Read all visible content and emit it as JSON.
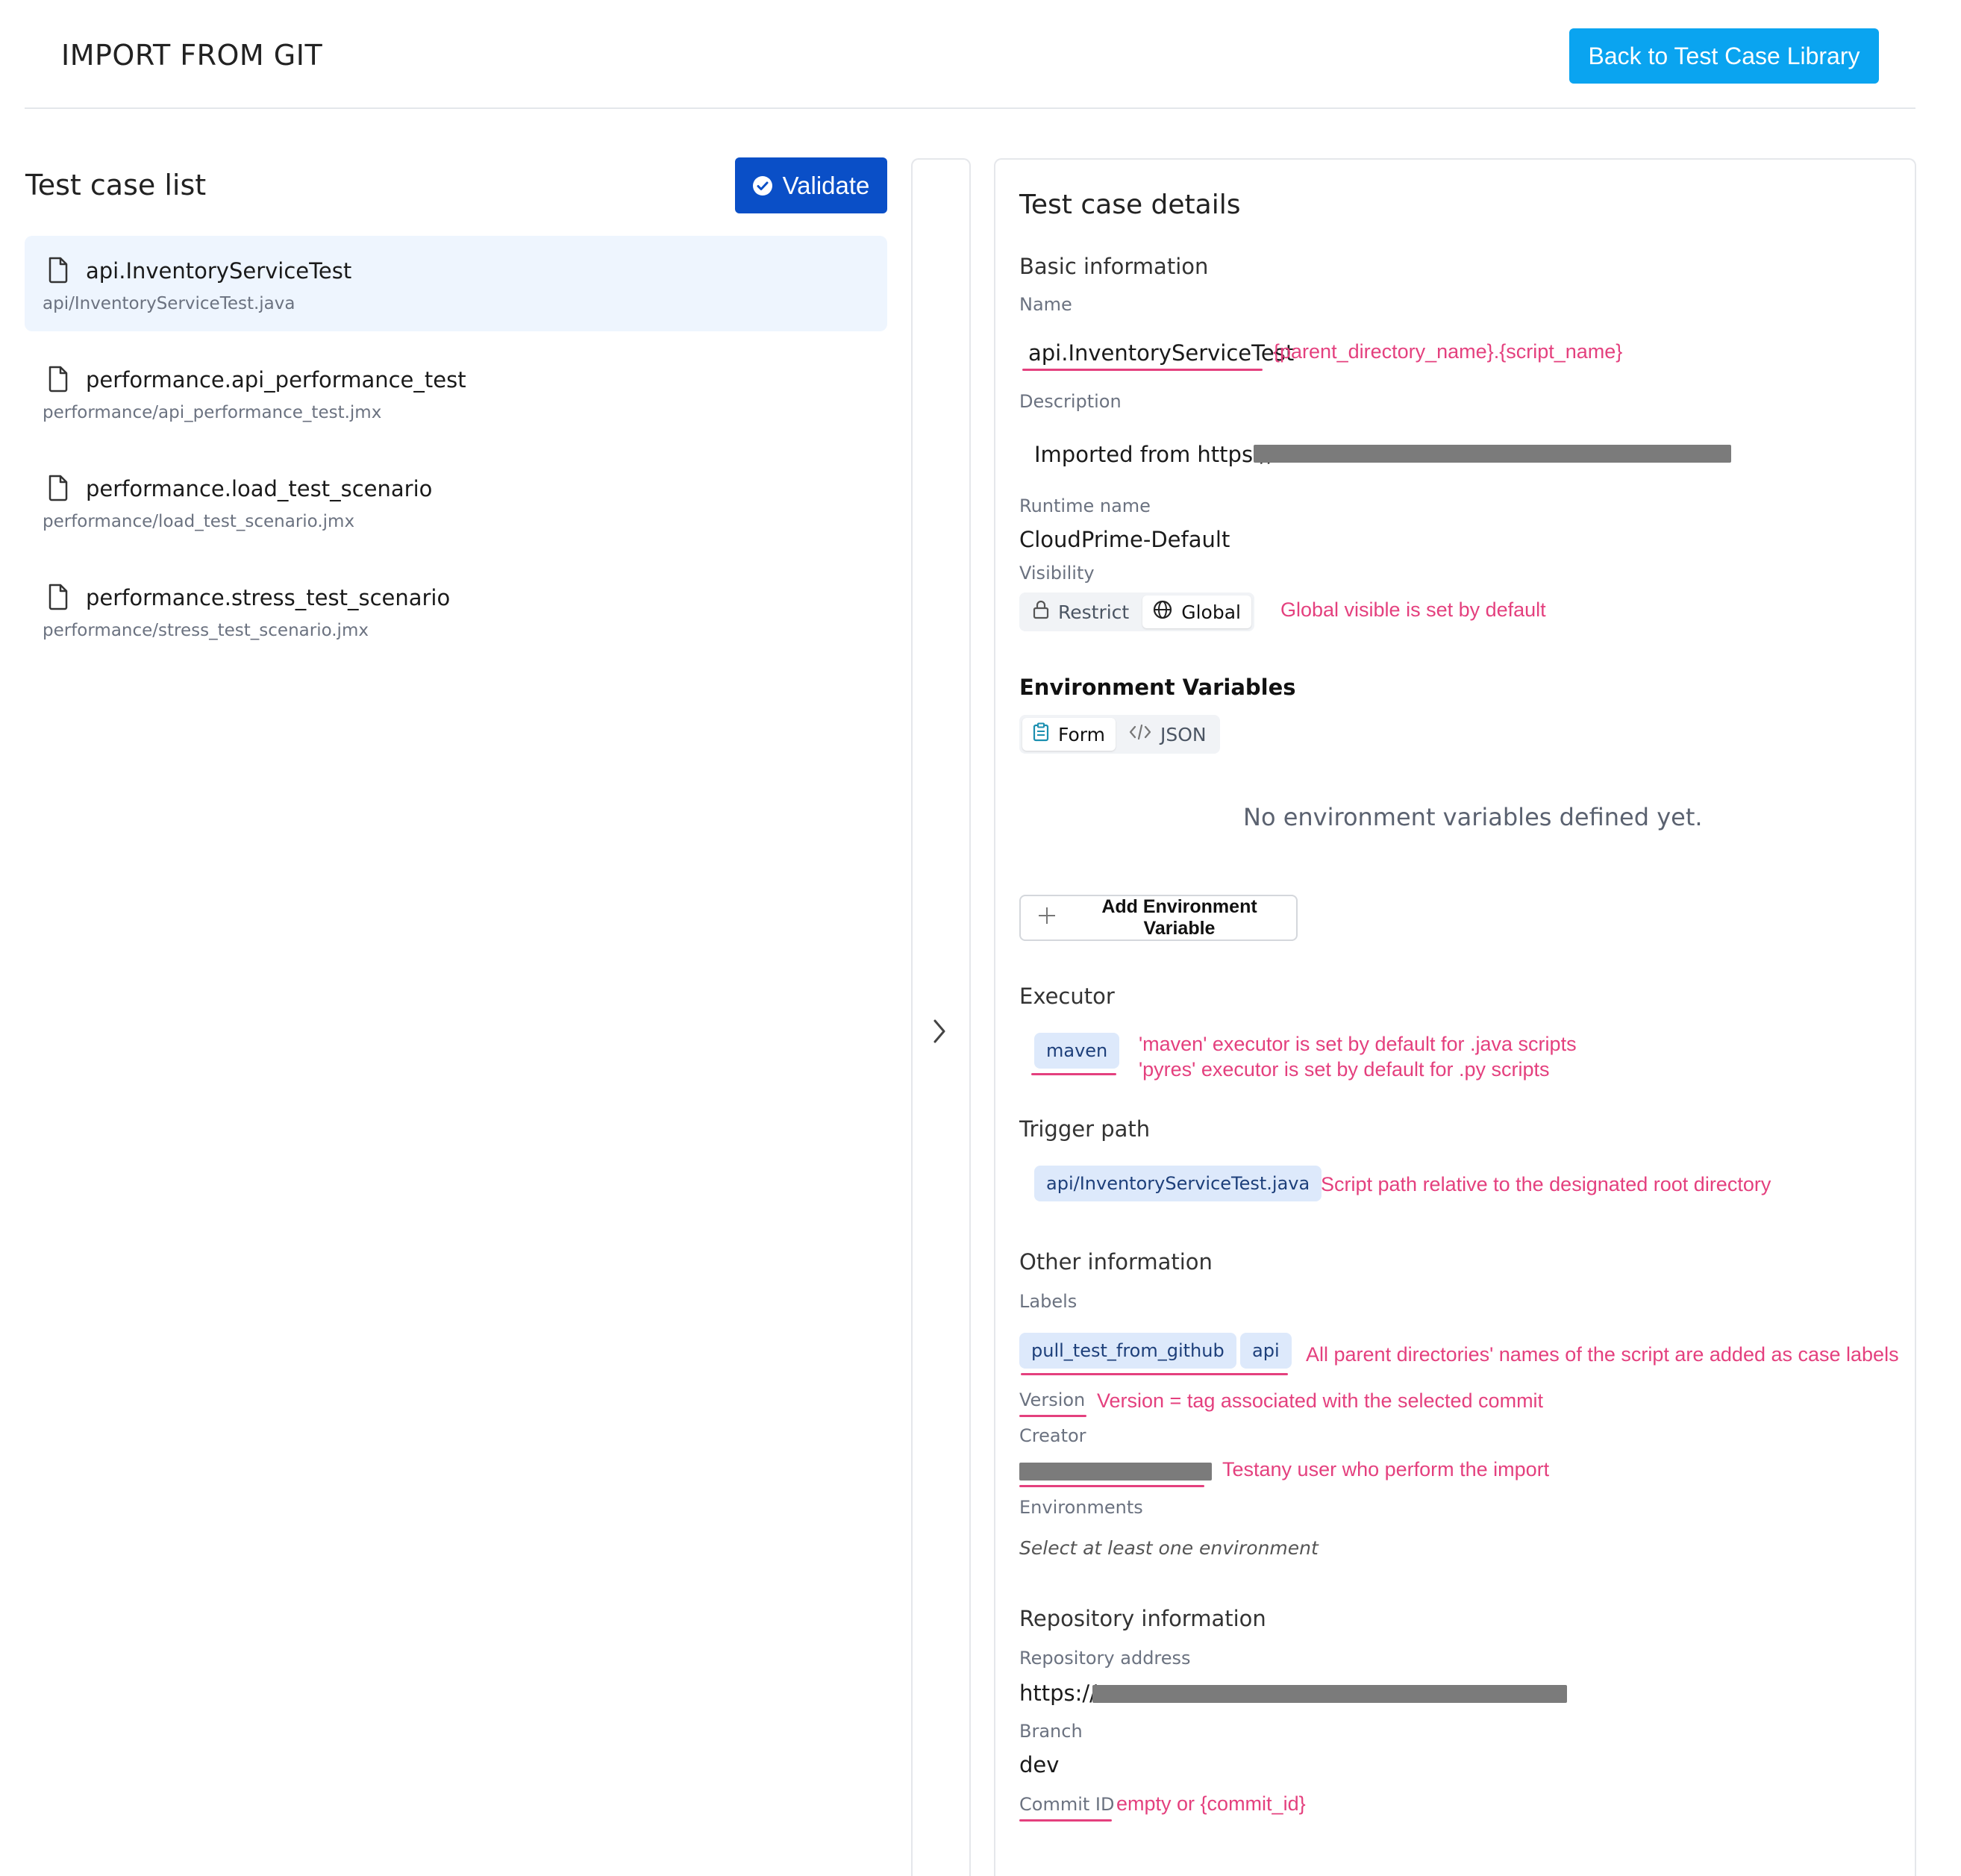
{
  "header": {
    "title": "IMPORT FROM GIT",
    "back_label": "Back to Test Case Library"
  },
  "test_case_list": {
    "title": "Test case list",
    "validate_label": "Validate",
    "items": [
      {
        "name": "api.InventoryServiceTest",
        "path": "api/InventoryServiceTest.java",
        "selected": true
      },
      {
        "name": "performance.api_performance_test",
        "path": "performance/api_performance_test.jmx",
        "selected": false
      },
      {
        "name": "performance.load_test_scenario",
        "path": "performance/load_test_scenario.jmx",
        "selected": false
      },
      {
        "name": "performance.stress_test_scenario",
        "path": "performance/stress_test_scenario.jmx",
        "selected": false
      }
    ]
  },
  "details": {
    "title": "Test case details",
    "basic": {
      "title": "Basic information",
      "name_label": "Name",
      "name_value": "api.InventoryServiceTest",
      "description_label": "Description",
      "description_value": "Imported from https://",
      "runtime_label": "Runtime name",
      "runtime_value": "CloudPrime-Default",
      "visibility_label": "Visibility",
      "visibility_options": [
        "Restrict",
        "Global"
      ],
      "visibility_selected": "Global"
    },
    "env": {
      "title": "Environment Variables",
      "mode_options": [
        "Form",
        "JSON"
      ],
      "mode_selected": "Form",
      "empty_message": "No environment variables defined yet.",
      "add_label": "Add Environment Variable"
    },
    "executor": {
      "title": "Executor",
      "value": "maven"
    },
    "trigger": {
      "title": "Trigger path",
      "value": "api/InventoryServiceTest.java"
    },
    "other": {
      "title": "Other information",
      "labels_label": "Labels",
      "labels": [
        "pull_test_from_github",
        "api"
      ],
      "version_label": "Version",
      "creator_label": "Creator",
      "environments_label": "Environments",
      "environments_placeholder": "Select at least one environment"
    },
    "repo": {
      "title": "Repository information",
      "address_label": "Repository address",
      "address_value": "https://",
      "branch_label": "Branch",
      "branch_value": "dev",
      "commit_label": "Commit ID"
    }
  },
  "annotations": {
    "name": "{parent_directory_name}.{script_name}",
    "visibility": "Global visible is set by default",
    "executor_line1": "'maven' executor is set by default for .java scripts",
    "executor_line2": "'pyres' executor is set by default for .py scripts",
    "trigger": "Script path relative to the designated root directory",
    "labels": "All parent directories' names of the script are added as case labels",
    "version": "Version = tag associated with the selected commit",
    "creator": "Testany user who perform the import",
    "commit": "empty or {commit_id}"
  },
  "colors": {
    "primary_button": "#0aa4f0",
    "validate_button": "#0a4fc7",
    "selected_item_bg": "#eef5fe",
    "annotation": "#e4407e",
    "chip_bg": "#dde9fb"
  }
}
